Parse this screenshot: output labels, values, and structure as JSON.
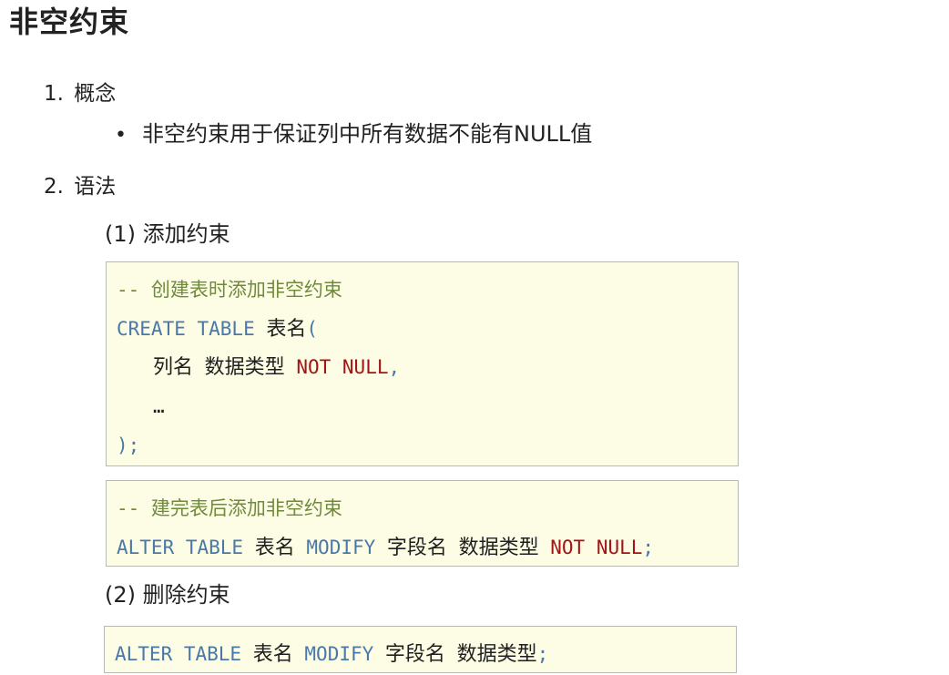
{
  "title": "非空约束",
  "sections": [
    {
      "number": "1.",
      "label": "概念"
    },
    {
      "number": "2.",
      "label": "语法"
    }
  ],
  "concept_bullet": "非空约束用于保证列中所有数据不能有NULL值",
  "subsections": [
    {
      "number": "(1)",
      "label": "添加约束"
    },
    {
      "number": "(2)",
      "label": "删除约束"
    }
  ],
  "code_add_create": {
    "comment": "-- 创建表时添加非空约束",
    "line1_kw": "CREATE TABLE",
    "line1_name": "表名",
    "line1_paren": "(",
    "line2_col": "列名",
    "line2_type": "数据类型",
    "line2_kw": "NOT NULL",
    "line2_comma": ",",
    "line3": "…",
    "line4": ");"
  },
  "code_add_alter": {
    "comment": "-- 建完表后添加非空约束",
    "kw1": "ALTER TABLE",
    "table": "表名",
    "kw2": "MODIFY",
    "field": "字段名",
    "type": "数据类型",
    "kw3": "NOT NULL",
    "semi": ";"
  },
  "code_drop": {
    "kw1": "ALTER TABLE",
    "table": "表名",
    "kw2": "MODIFY",
    "field": "字段名",
    "type": "数据类型",
    "semi": ";"
  },
  "colors": {
    "code_background": "#fdfde5",
    "keyword": "#4a78a8",
    "not_null": "#a31515",
    "comment": "#6f8a3a"
  }
}
